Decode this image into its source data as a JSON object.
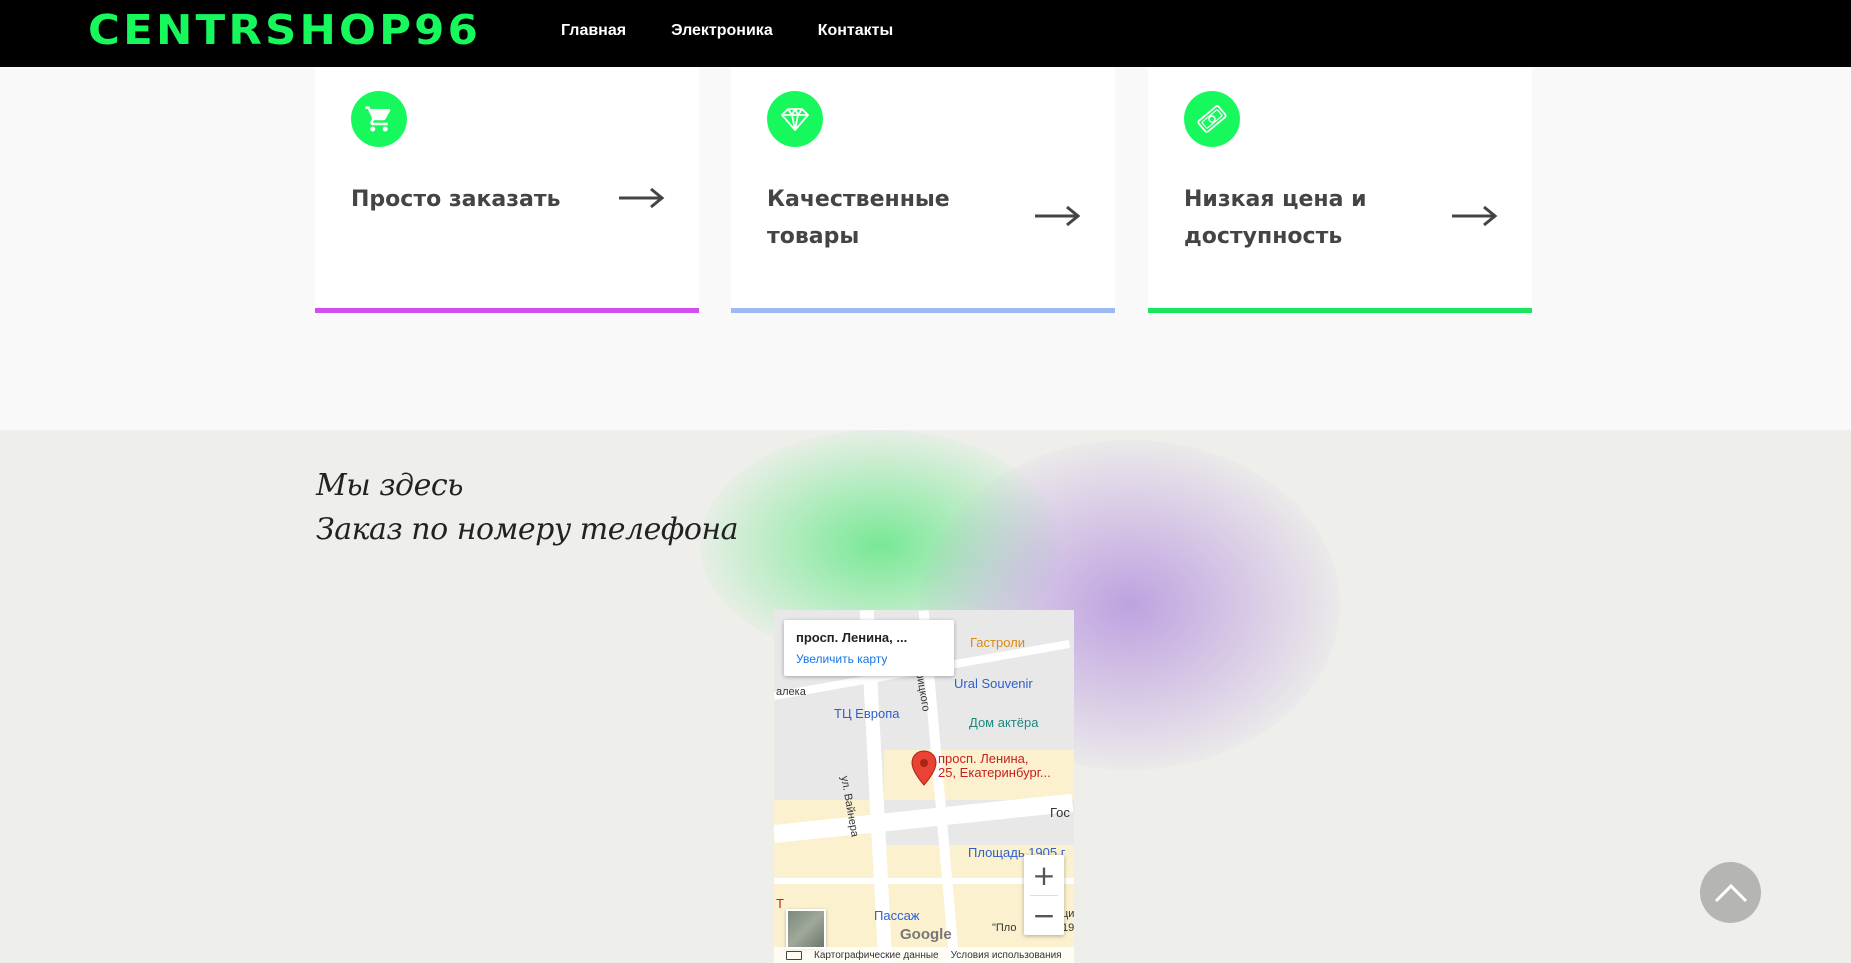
{
  "header": {
    "logo": "CENTRSHOP96",
    "nav": [
      "Главная",
      "Электроника",
      "Контакты"
    ],
    "logo_color": "#17f85d"
  },
  "features": [
    {
      "title": "Просто заказать",
      "icon": "shopping-cart-icon",
      "bar_color": "#d34eef"
    },
    {
      "title": "Качественные товары",
      "icon": "diamond-icon",
      "bar_color": "#9bb9f3"
    },
    {
      "title": "Низкая цена и доступность",
      "icon": "money-icon",
      "bar_color": "#1ae55f"
    }
  ],
  "location": {
    "line1": "Мы здесь",
    "line2": "Заказ по номеру телефона"
  },
  "map": {
    "info_address": "просп. Ленина, ...",
    "info_link": "Увеличить карту",
    "pin_label_1": "просп. Ленина,",
    "pin_label_2": "25, Екатеринбург...",
    "places": {
      "gastroli": "Гастроли",
      "ural_souvenir": "Ural Souvenir",
      "tc_europa": "ТЦ Европа",
      "dom_aktera": "Дом актёра",
      "ploshchad": "Площадь 1905 г",
      "passazh": "Пассаж",
      "gos": "Гос",
      "aleka": "алека",
      "vainera": "ул. Вайнера",
      "uritskogo": "Урицкого",
      "t_letter": "Т",
      "tsi": "ци",
      "plo": "\"Пло",
      "nineteen": "19"
    },
    "google": "Google",
    "zoom_in": "+",
    "zoom_out": "−",
    "attribution_data": "Картографические данные",
    "attribution_terms": "Условия использования"
  }
}
